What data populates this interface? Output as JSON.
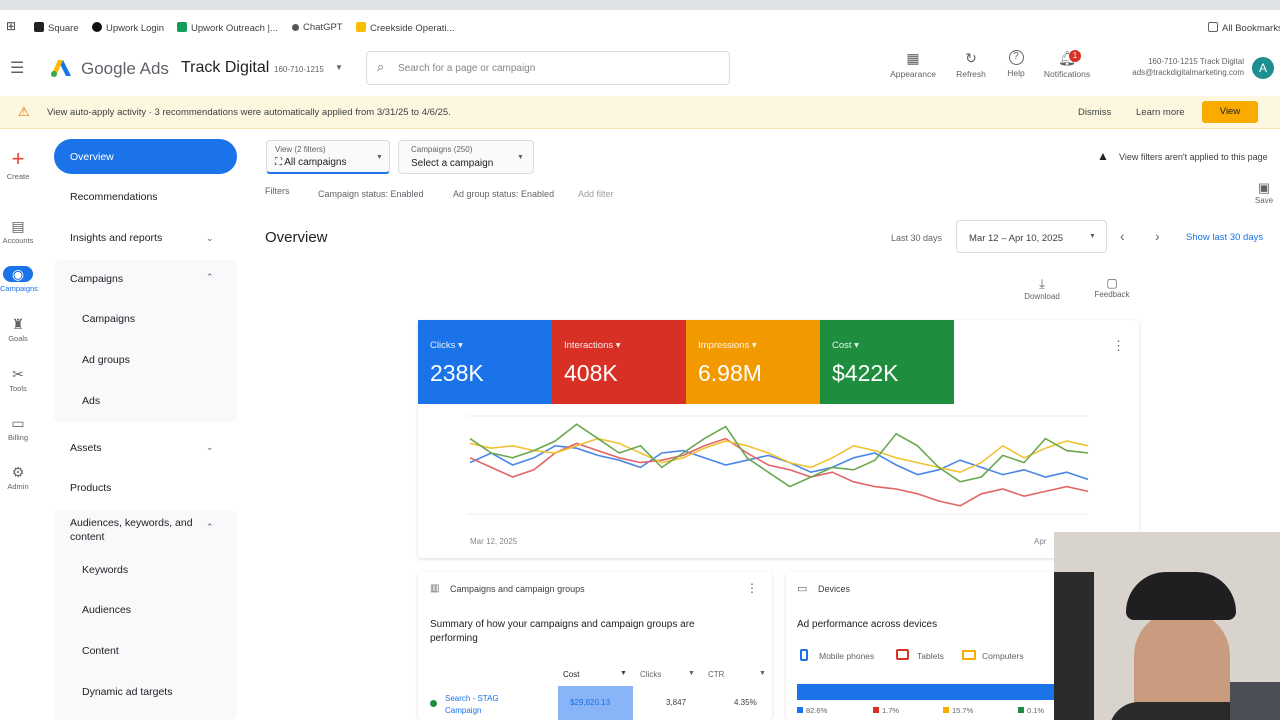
{
  "bookmarks": [
    "Square",
    "Upwork Login",
    "Upwork Outreach |...",
    "ChatGPT",
    "Creekside Operati...",
    "All Bookmarks"
  ],
  "brand": {
    "product": "Google Ads",
    "account": "Track Digital",
    "account_id": "160-710-1215"
  },
  "search": {
    "placeholder": "Search for a page or campaign"
  },
  "header_actions": {
    "appearance": "Appearance",
    "refresh": "Refresh",
    "help": "Help",
    "notifications": "Notifications",
    "notif_count": "1"
  },
  "account_info": {
    "line1": "160-710-1215 Track Digital",
    "line2": "ads@trackdigitalmarketing.com",
    "avatar": "A"
  },
  "notice": {
    "text": "View auto-apply activity · 3 recommendations were automatically applied from 3/31/25 to 4/6/25.",
    "dismiss": "Dismiss",
    "learn_more": "Learn more",
    "view": "View"
  },
  "rail": [
    "Create",
    "Accounts",
    "Campaigns",
    "Goals",
    "Tools",
    "Billing",
    "Admin"
  ],
  "nav": {
    "overview": "Overview",
    "recommendations": "Recommendations",
    "insights": "Insights and reports",
    "campaigns_group": "Campaigns",
    "campaigns": "Campaigns",
    "ad_groups": "Ad groups",
    "ads": "Ads",
    "assets": "Assets",
    "products": "Products",
    "audiences_group": "Audiences, keywords, and content",
    "keywords": "Keywords",
    "audiences": "Audiences",
    "content": "Content",
    "dynamic": "Dynamic ad targets"
  },
  "filters": {
    "view_label": "View (2 filters)",
    "view_value": "All campaigns",
    "campaign_label": "Campaigns (250)",
    "campaign_value": "Select a campaign",
    "filters_label": "Filters",
    "status1": "Campaign status: Enabled",
    "status2": "Ad group status: Enabled",
    "add": "Add filter",
    "warning": "View filters aren't applied to this page",
    "save": "Save"
  },
  "page": {
    "title": "Overview",
    "range_label": "Last 30 days",
    "range": "Mar 12 – Apr 10, 2025",
    "show_last": "Show last 30 days",
    "download": "Download",
    "feedback": "Feedback"
  },
  "metrics": [
    {
      "label": "Clicks",
      "value": "238K",
      "color": "#1a73e8"
    },
    {
      "label": "Interactions",
      "value": "408K",
      "color": "#d93025"
    },
    {
      "label": "Impressions",
      "value": "6.98M",
      "color": "#f29900"
    },
    {
      "label": "Cost",
      "value": "$422K",
      "color": "#1e8e3e"
    }
  ],
  "chart_data": {
    "type": "line",
    "x_start_label": "Mar 12, 2025",
    "x_end_label": "Apr",
    "series": [
      {
        "name": "Clicks",
        "color": "#4a86e8",
        "values": [
          48,
          52,
          47,
          50,
          55,
          54,
          51,
          49,
          46,
          52,
          53,
          50,
          47,
          49,
          51,
          48,
          44,
          46,
          50,
          52,
          47,
          43,
          45,
          49,
          46,
          43,
          45,
          42,
          44,
          41
        ]
      },
      {
        "name": "Interactions",
        "color": "#e06666",
        "values": [
          50,
          46,
          42,
          45,
          52,
          56,
          53,
          50,
          48,
          49,
          51,
          55,
          58,
          52,
          47,
          45,
          42,
          44,
          40,
          38,
          37,
          35,
          32,
          30,
          35,
          37,
          34,
          36,
          38,
          36
        ]
      },
      {
        "name": "Impressions",
        "color": "#f1c232",
        "values": [
          56,
          54,
          55,
          53,
          52,
          55,
          58,
          56,
          52,
          48,
          50,
          54,
          57,
          55,
          52,
          48,
          46,
          50,
          55,
          53,
          50,
          48,
          46,
          44,
          48,
          55,
          50,
          54,
          57,
          55
        ]
      },
      {
        "name": "Cost",
        "color": "#6aa84f",
        "values": [
          58,
          52,
          50,
          53,
          57,
          64,
          58,
          52,
          55,
          46,
          52,
          58,
          63,
          50,
          44,
          38,
          42,
          46,
          45,
          49,
          60,
          55,
          46,
          40,
          42,
          51,
          48,
          58,
          53,
          52
        ]
      }
    ]
  },
  "campaigns_card": {
    "title": "Campaigns and campaign groups",
    "summary": "Summary of how your campaigns and campaign groups are performing",
    "cols": [
      "Cost",
      "Clicks",
      "CTR"
    ],
    "row": {
      "name": "Search - STAG Campaign",
      "cost": "$29,820.13",
      "clicks": "3,847",
      "ctr": "4.35%"
    }
  },
  "devices_card": {
    "title": "Devices",
    "subtitle": "Ad performance across devices",
    "legend": [
      "Mobile phones",
      "Tablets",
      "Computers"
    ],
    "shares": [
      {
        "label": "82.6%",
        "color": "#1a73e8",
        "value": 82.6
      },
      {
        "label": "1.7%",
        "color": "#d93025",
        "value": 1.7
      },
      {
        "label": "15.7%",
        "color": "#f9ab00",
        "value": 15.7
      }
    ],
    "extra": "0.1%"
  }
}
